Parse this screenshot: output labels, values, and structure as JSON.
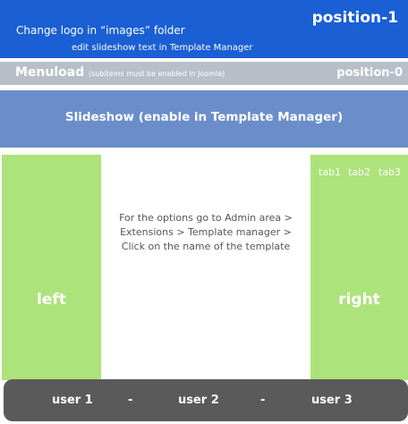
{
  "header": {
    "logo_text": "Change logo in “images” folder",
    "slideshow_text": "edit slideshow text in Template Manager",
    "position_label": "position-1",
    "color": "#1a5fd3"
  },
  "menubar": {
    "title": "Menuload",
    "note": "(subitems must be enabled in Joomla)",
    "position_label": "position-0",
    "color": "#b9bfc9"
  },
  "slideshow": {
    "label": "Slideshow (enable in Template Manager)",
    "color": "#6b8ecb"
  },
  "left": {
    "label": "left",
    "color": "#ade37b"
  },
  "main": {
    "lines": [
      "For the options go to Admin area >",
      "Extensions > Template manager >",
      "Click on the name of the template"
    ]
  },
  "right": {
    "tabs": [
      "tab1",
      "tab2",
      "tab3"
    ],
    "label": "right",
    "color": "#ade37b"
  },
  "footer": {
    "items": [
      "user 1",
      "-",
      "user 2",
      "-",
      "user 3"
    ],
    "color": "#5a5a5a"
  }
}
